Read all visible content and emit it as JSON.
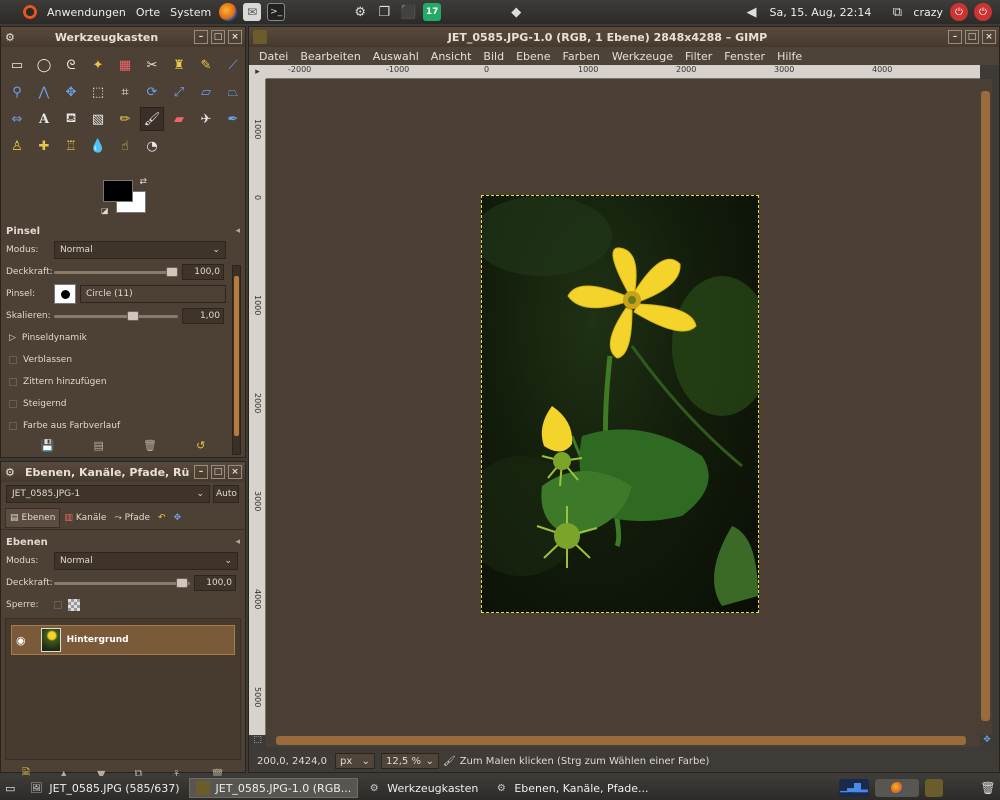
{
  "top_panel": {
    "menus": [
      "Anwendungen",
      "Orte",
      "System"
    ],
    "clock": "Sa, 15. Aug, 22:14",
    "user": "crazy"
  },
  "toolbox": {
    "title": "Werkzeugkasten",
    "options_title": "Pinsel",
    "mode_label": "Modus:",
    "mode_value": "Normal",
    "opacity_label": "Deckkraft:",
    "opacity_value": "100,0",
    "opacity_level": 1.0,
    "brush_label": "Pinsel:",
    "brush_value": "Circle (11)",
    "scale_label": "Skalieren:",
    "scale_value": "1,00",
    "scale_level": 0.65,
    "dynamics_label": "Pinseldynamik",
    "checks": [
      "Verblassen",
      "Zittern hinzufügen",
      "Steigernd",
      "Farbe aus Farbverlauf"
    ]
  },
  "layers": {
    "title": "Ebenen, Kanäle, Pfade, Rü",
    "image_select": "JET_0585.JPG-1",
    "auto_button": "Auto",
    "tabs": [
      "Ebenen",
      "Kanäle",
      "Pfade"
    ],
    "section_title": "Ebenen",
    "mode_label": "Modus:",
    "mode_value": "Normal",
    "opacity_label": "Deckkraft:",
    "opacity_value": "100,0",
    "lock_label": "Sperre:",
    "layer_name": "Hintergrund"
  },
  "main": {
    "title": "JET_0585.JPG-1.0 (RGB, 1 Ebene) 2848x4288 – GIMP",
    "menus": [
      "Datei",
      "Bearbeiten",
      "Auswahl",
      "Ansicht",
      "Bild",
      "Ebene",
      "Farben",
      "Werkzeuge",
      "Filter",
      "Fenster",
      "Hilfe"
    ],
    "ruler_h_labels": [
      "-2000",
      "-1000",
      "0",
      "1000",
      "2000",
      "3000",
      "4000"
    ],
    "ruler_v_labels": [
      "1000",
      "0",
      "1000",
      "2000",
      "3000",
      "4000",
      "5000"
    ],
    "coords": "200,0, 2424,0",
    "unit": "px",
    "zoom": "12,5 %",
    "status_msg": "Zum Malen klicken (Strg zum Wählen einer Farbe)"
  },
  "taskbar": {
    "tasks": [
      "JET_0585.JPG  (585/637)",
      "JET_0585.JPG-1.0 (RGB...",
      "Werkzeugkasten",
      "Ebenen, Kanäle, Pfade..."
    ]
  },
  "colors": {
    "accent": "#e9541f",
    "selection_row": "#7b5a3a",
    "canvas_bg": "#4b3f35",
    "flower": "#f4d42a"
  }
}
